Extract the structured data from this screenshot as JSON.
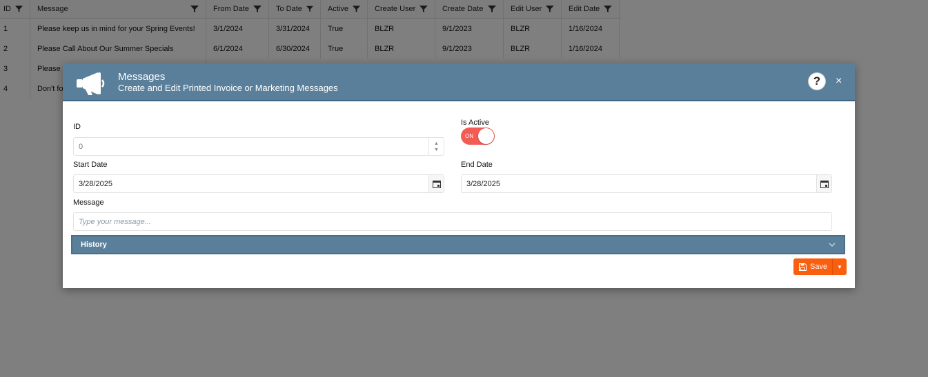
{
  "grid": {
    "columns": [
      "ID",
      "Message",
      "From Date",
      "To Date",
      "Active",
      "Create User",
      "Create Date",
      "Edit User",
      "Edit Date"
    ],
    "rows": [
      [
        "1",
        "Please keep us in mind for your Spring Events!",
        "3/1/2024",
        "3/31/2024",
        "True",
        "BLZR",
        "9/1/2023",
        "BLZR",
        "1/16/2024"
      ],
      [
        "2",
        "Please Call About Our Summer Specials",
        "6/1/2024",
        "6/30/2024",
        "True",
        "BLZR",
        "9/1/2023",
        "BLZR",
        "1/16/2024"
      ],
      [
        "3",
        "Please",
        "",
        "",
        "",
        "",
        "",
        "",
        ""
      ],
      [
        "4",
        "Don't fo",
        "",
        "",
        "",
        "",
        "",
        "",
        ""
      ]
    ]
  },
  "dialog": {
    "title": "Messages",
    "subtitle": "Create and Edit Printed Invoice or Marketing Messages",
    "help_label": "?",
    "close_label": "×",
    "id_label": "ID",
    "id_value": "0",
    "is_active_label": "Is Active",
    "toggle_label": "ON",
    "start_date_label": "Start Date",
    "start_date_value": "3/28/2025",
    "end_date_label": "End Date",
    "end_date_value": "3/28/2025",
    "message_label": "Message",
    "message_placeholder": "Type your message...",
    "history_label": "History",
    "save_label": "Save"
  },
  "colors": {
    "header_bg": "#5a7f9a",
    "toggle_on": "#f25c54",
    "save_button": "#fa5e0f"
  },
  "icons": {
    "header": "megaphone-icon",
    "filter": "filter-icon",
    "calendar": "calendar-icon",
    "save": "save-icon"
  }
}
